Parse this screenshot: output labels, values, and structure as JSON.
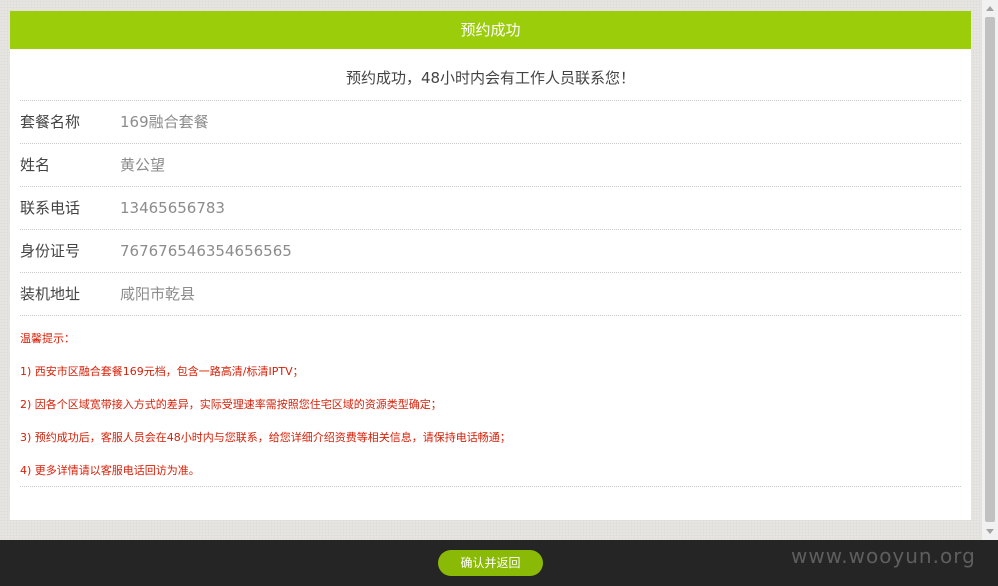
{
  "header": {
    "title": "预约成功"
  },
  "notice": "预约成功，48小时内会有工作人员联系您！",
  "details": [
    {
      "label": "套餐名称",
      "value": "169融合套餐"
    },
    {
      "label": "姓名",
      "value": "黄公望"
    },
    {
      "label": "联系电话",
      "value": "13465656783"
    },
    {
      "label": "身份证号",
      "value": "767676546354656565"
    },
    {
      "label": "装机地址",
      "value": "咸阳市乾县"
    }
  ],
  "tips": {
    "title": "温馨提示：",
    "items": [
      "1) 西安市区融合套餐169元档，包含一路高清/标清IPTV；",
      "2) 因各个区域宽带接入方式的差异，实际受理速率需按照您住宅区域的资源类型确定；",
      "3) 预约成功后，客服人员会在48小时内与您联系，给您详细介绍资费等相关信息，请保持电话畅通；",
      "4) 更多详情请以客服电话回访为准。"
    ]
  },
  "footer": {
    "confirm_label": "确认并返回",
    "watermark": "www.wooyun.org"
  },
  "colors": {
    "header_green": "#9ccd0b",
    "button_green": "#8aba06",
    "tip_red": "#d81e06",
    "footer_dark": "#252525"
  }
}
